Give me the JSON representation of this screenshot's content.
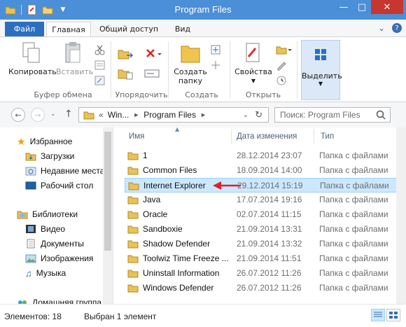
{
  "window": {
    "title": "Program Files"
  },
  "tabs": {
    "file": "Файл",
    "home": "Главная",
    "share": "Общий доступ",
    "view": "Вид"
  },
  "ribbon": {
    "copy": "Копировать",
    "paste": "Вставить",
    "clipboard_group": "Буфер обмена",
    "organize_group": "Упорядочить",
    "new_folder_line1": "Создать",
    "new_folder_line2": "папку",
    "create_group": "Создать",
    "properties": "Свойства",
    "open_group": "Открыть",
    "select": "Выделить"
  },
  "address": {
    "chevron": "«",
    "crumbs": [
      "Win...",
      "Program Files"
    ],
    "search_placeholder": "Поиск: Program Files"
  },
  "nav": {
    "favorites": "Избранное",
    "downloads": "Загрузки",
    "recent": "Недавние места",
    "desktop": "Рабочий стол",
    "libraries": "Библиотеки",
    "video": "Видео",
    "documents": "Документы",
    "images": "Изображения",
    "music": "Музыка",
    "homegroup": "Домашняя группа"
  },
  "columns": {
    "name": "Имя",
    "date": "Дата изменения",
    "type": "Тип"
  },
  "files": [
    {
      "name": "1",
      "date": "28.12.2014 23:07",
      "type": "Папка с файлами"
    },
    {
      "name": "Common Files",
      "date": "18.09.2014 14:00",
      "type": "Папка с файлами"
    },
    {
      "name": "Internet Explorer",
      "date": "29.12.2014 15:19",
      "type": "Папка с файлами"
    },
    {
      "name": "Java",
      "date": "17.07.2014 19:16",
      "type": "Папка с файлами"
    },
    {
      "name": "Oracle",
      "date": "02.07.2014 11:15",
      "type": "Папка с файлами"
    },
    {
      "name": "Sandboxie",
      "date": "21.09.2014 13:31",
      "type": "Папка с файлами"
    },
    {
      "name": "Shadow Defender",
      "date": "21.09.2014 13:32",
      "type": "Папка с файлами"
    },
    {
      "name": "Toolwiz Time Freeze ...",
      "date": "21.09.2014 11:51",
      "type": "Папка с файлами"
    },
    {
      "name": "Uninstall Information",
      "date": "26.07.2012 11:26",
      "type": "Папка с файлами"
    },
    {
      "name": "Windows Defender",
      "date": "26.07.2012 11:26",
      "type": "Папка с файлами"
    }
  ],
  "status": {
    "count": "Элементов: 18",
    "selected": "Выбран 1 элемент"
  },
  "colors": {
    "accent": "#4b8fd8",
    "file_tab": "#2c6fc1",
    "selection": "#cce8ff",
    "arrow": "#e0202a"
  }
}
